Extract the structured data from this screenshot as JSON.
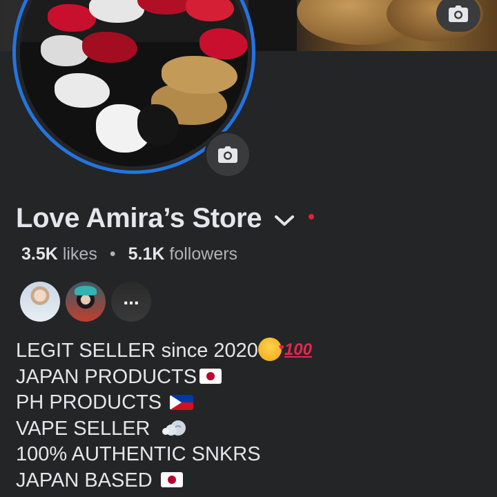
{
  "page": {
    "name": "Love Amira’s Store",
    "likes_count": "3.5K",
    "likes_label": "likes",
    "separator": "•",
    "followers_count": "5.1K",
    "followers_label": "followers",
    "more_friends_label": "..."
  },
  "bio": {
    "line1": "LEGIT SELLER since 2020",
    "line2": "JAPAN PRODUCTS",
    "line3": "PH PRODUCTS ",
    "line4": "VAPE SELLER ",
    "line5": "100% AUTHENTIC SNKRS",
    "line6": "JAPAN BASED ",
    "emoji_100": "100"
  },
  "icons": {
    "cover_camera": "camera-icon",
    "avatar_camera": "camera-icon",
    "title_dropdown": "chevron-down-icon",
    "status_dot": "red-dot-icon"
  },
  "colors": {
    "background": "#242526",
    "avatar_ring": "#2374e1",
    "status_dot": "#e41e3f",
    "text_primary": "#e4e6eb",
    "text_secondary": "#b0b3b8"
  }
}
